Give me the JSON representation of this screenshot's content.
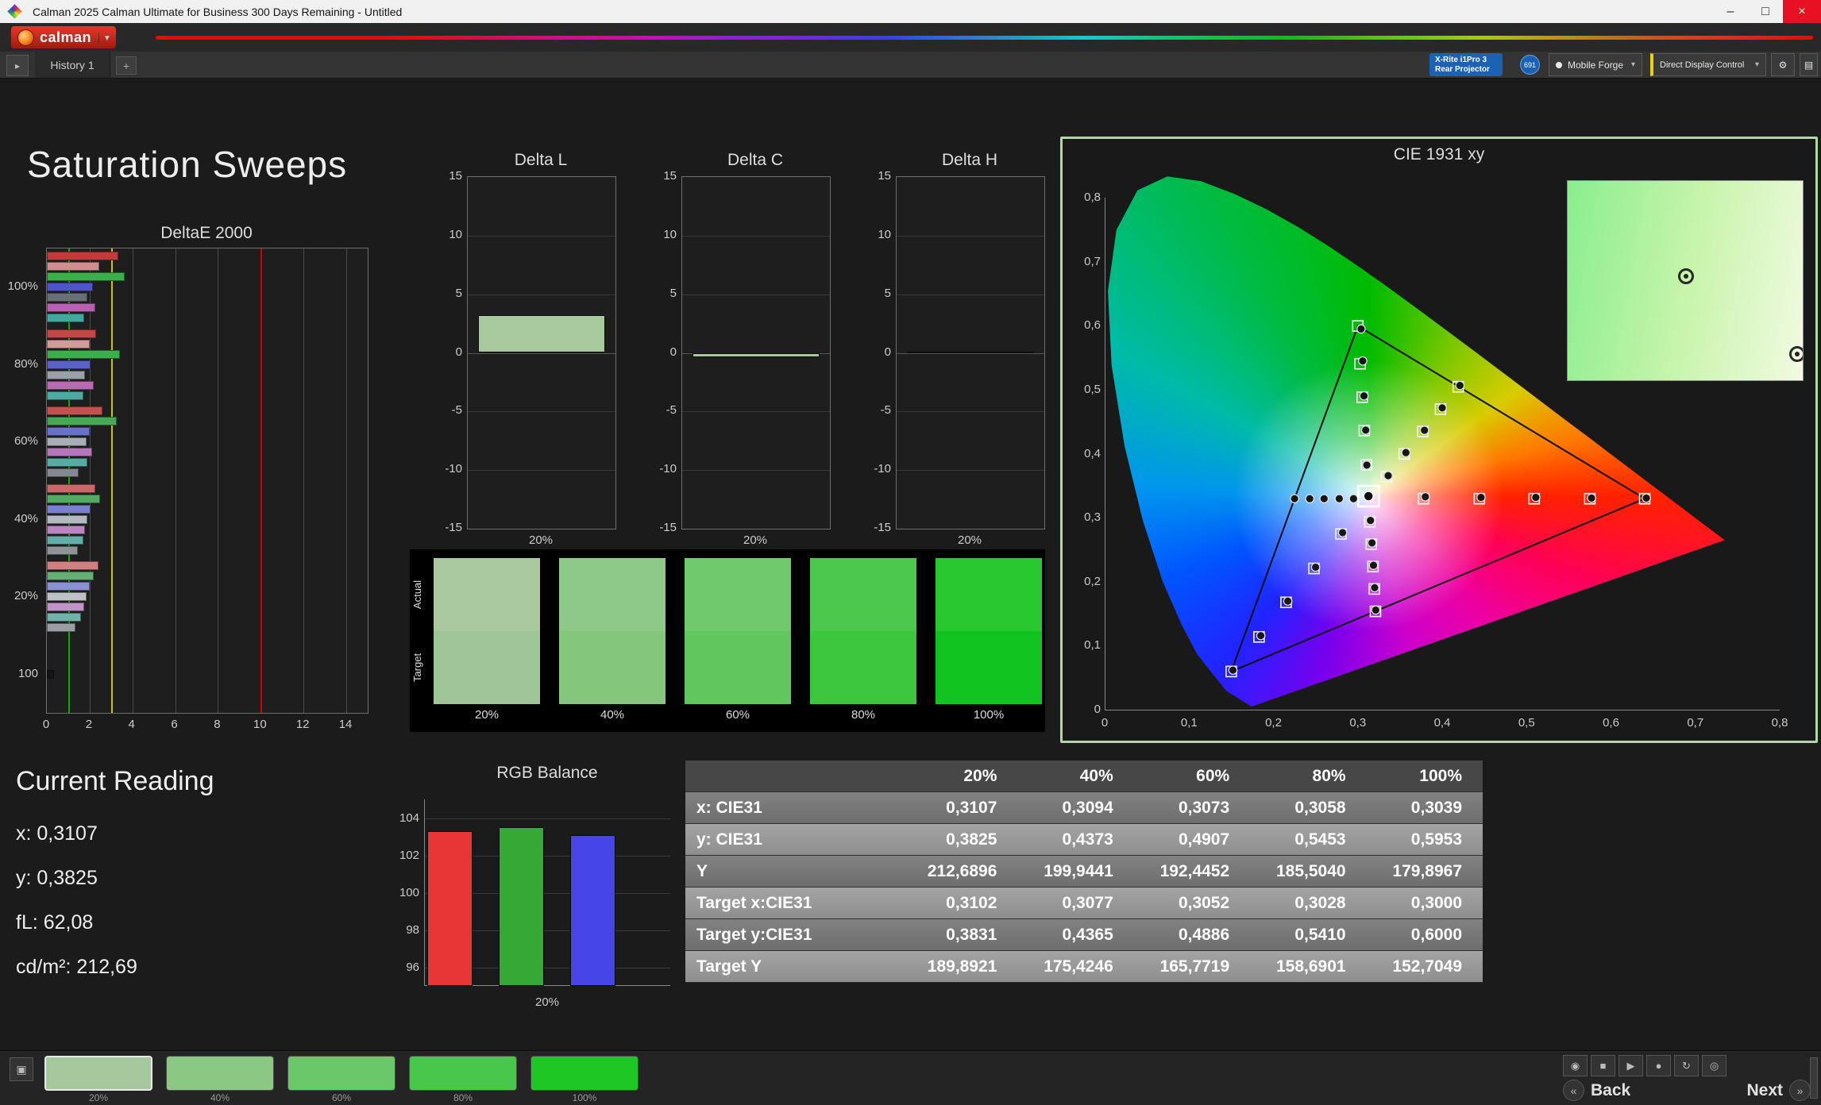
{
  "titlebar": {
    "title": "Calman 2025 Calman Ultimate for Business 300 Days Remaining  - Untitled"
  },
  "toolbar": {
    "brand": "calman"
  },
  "tabbar": {
    "tab": "History 1",
    "device_line1": "X-Rite i1Pro 3",
    "device_line2": "Rear Projector",
    "badge": "691",
    "source": "Mobile Forge",
    "display_control": "Direct Display Control"
  },
  "page": {
    "title": "Saturation Sweeps"
  },
  "icons": {
    "app": "◆",
    "minimize": "–",
    "maximize": "□",
    "close": "×",
    "caret": "▾",
    "history_toggle": "▸",
    "add_tab": "+",
    "gear": "⚙",
    "layout": "▤",
    "capture": "▣",
    "camera": "◉",
    "stop": "■",
    "play": "▶",
    "record": "●",
    "refresh": "↻",
    "power": "◎",
    "back_arrow": "«",
    "next_arrow": "»"
  },
  "deltae_chart": {
    "title": "DeltaE 2000",
    "xmax": 15,
    "xticks": [
      0,
      2,
      4,
      6,
      8,
      10,
      12,
      14
    ],
    "ref_lines": [
      {
        "value": 1,
        "color": "#00b400"
      },
      {
        "value": 3,
        "color": "#c8c800"
      },
      {
        "value": 10,
        "color": "#d40000"
      }
    ],
    "groups": [
      {
        "label": "100%",
        "bars": [
          {
            "color": "#c23a3a",
            "value": 3.35
          },
          {
            "color": "#cf8f8f",
            "value": 2.45
          },
          {
            "color": "#3dae4c",
            "value": 3.65
          },
          {
            "color": "#4d55c9",
            "value": 2.15
          },
          {
            "color": "#6a6f77",
            "value": 1.9
          },
          {
            "color": "#bb5fb4",
            "value": 2.25
          },
          {
            "color": "#43a8a0",
            "value": 1.75
          }
        ]
      },
      {
        "label": "80%",
        "bars": [
          {
            "color": "#c24747",
            "value": 2.3
          },
          {
            "color": "#d39a9a",
            "value": 2.0
          },
          {
            "color": "#3dae4c",
            "value": 3.4
          },
          {
            "color": "#5a62c9",
            "value": 2.05
          },
          {
            "color": "#9aa0a8",
            "value": 1.8
          },
          {
            "color": "#b76bb1",
            "value": 2.2
          },
          {
            "color": "#4daaa2",
            "value": 1.7
          }
        ]
      },
      {
        "label": "60%",
        "bars": [
          {
            "color": "#c25252",
            "value": 2.6
          },
          {
            "color": "#46a855",
            "value": 3.25
          },
          {
            "color": "#6a71c9",
            "value": 2.0
          },
          {
            "color": "#a8aeb6",
            "value": 1.85
          },
          {
            "color": "#b377ba",
            "value": 2.1
          },
          {
            "color": "#57aca4",
            "value": 1.9
          },
          {
            "color": "#84888f",
            "value": 1.5
          }
        ]
      },
      {
        "label": "40%",
        "bars": [
          {
            "color": "#c96868",
            "value": 2.25
          },
          {
            "color": "#55aa63",
            "value": 2.5
          },
          {
            "color": "#7a80cd",
            "value": 2.05
          },
          {
            "color": "#b3b9c0",
            "value": 1.9
          },
          {
            "color": "#ba85c0",
            "value": 1.8
          },
          {
            "color": "#63aea6",
            "value": 1.7
          },
          {
            "color": "#8f9399",
            "value": 1.45
          }
        ]
      },
      {
        "label": "20%",
        "bars": [
          {
            "color": "#d08080",
            "value": 2.4
          },
          {
            "color": "#66ae72",
            "value": 2.2
          },
          {
            "color": "#8a90d1",
            "value": 2.0
          },
          {
            "color": "#bdc2c9",
            "value": 1.85
          },
          {
            "color": "#c094c6",
            "value": 1.75
          },
          {
            "color": "#70b2aa",
            "value": 1.6
          },
          {
            "color": "#9a9ea4",
            "value": 1.35
          }
        ]
      },
      {
        "label": "100",
        "bars": [
          {
            "color": "#141414",
            "value": 0.35
          }
        ]
      }
    ]
  },
  "delta_yticks": [
    15,
    10,
    5,
    0,
    -5,
    -10,
    -15
  ],
  "delta_charts": [
    {
      "title": "Delta L",
      "value": 3.2,
      "color": "#a8c89e",
      "xlabel": "20%"
    },
    {
      "title": "Delta C",
      "value": -0.35,
      "color": "#a8c89e",
      "xlabel": "20%"
    },
    {
      "title": "Delta H",
      "value": 0.08,
      "color": "#1a1a1a",
      "xlabel": "20%"
    }
  ],
  "swatches": {
    "row_labels": [
      "Actual",
      "Target"
    ],
    "items": [
      {
        "label": "20%",
        "actual": "#aac9a1",
        "target": "#a0c599"
      },
      {
        "label": "40%",
        "actual": "#8fc987",
        "target": "#83c67c"
      },
      {
        "label": "60%",
        "actual": "#70c96c",
        "target": "#62c65f"
      },
      {
        "label": "80%",
        "actual": "#4cc94c",
        "target": "#3bc63e"
      },
      {
        "label": "100%",
        "actual": "#27c92e",
        "target": "#0fc41e"
      }
    ]
  },
  "cie": {
    "title": "CIE 1931 xy",
    "xtick_labels": [
      "0",
      "0,1",
      "0,2",
      "0,3",
      "0,4",
      "0,5",
      "0,6",
      "0,7",
      "0,8"
    ],
    "ytick_labels": [
      "0",
      "0,1",
      "0,2",
      "0,3",
      "0,4",
      "0,5",
      "0,6",
      "0,7",
      "0,8"
    ],
    "gamut": [
      [
        0.64,
        0.33
      ],
      [
        0.3,
        0.6
      ],
      [
        0.15,
        0.06
      ]
    ],
    "white_point": [
      0.3127,
      0.334
    ],
    "squares": [
      [
        0.378,
        0.33
      ],
      [
        0.444,
        0.33
      ],
      [
        0.509,
        0.33
      ],
      [
        0.575,
        0.33
      ],
      [
        0.64,
        0.33
      ],
      [
        0.3102,
        0.3831
      ],
      [
        0.3077,
        0.4365
      ],
      [
        0.3052,
        0.4886
      ],
      [
        0.3028,
        0.541
      ],
      [
        0.3,
        0.6
      ],
      [
        0.28,
        0.275
      ],
      [
        0.248,
        0.221
      ],
      [
        0.215,
        0.168
      ],
      [
        0.183,
        0.114
      ],
      [
        0.15,
        0.06
      ],
      [
        0.3143,
        0.294
      ],
      [
        0.316,
        0.259
      ],
      [
        0.318,
        0.224
      ],
      [
        0.3195,
        0.189
      ],
      [
        0.3209,
        0.154
      ],
      [
        0.334,
        0.364
      ],
      [
        0.355,
        0.4
      ],
      [
        0.377,
        0.435
      ],
      [
        0.398,
        0.47
      ],
      [
        0.419,
        0.505
      ]
    ],
    "circles": [
      [
        0.3107,
        0.3825
      ],
      [
        0.3094,
        0.4373
      ],
      [
        0.3073,
        0.4907
      ],
      [
        0.3058,
        0.5453
      ],
      [
        0.3039,
        0.5953
      ],
      [
        0.38,
        0.333
      ],
      [
        0.446,
        0.332
      ],
      [
        0.511,
        0.332
      ],
      [
        0.577,
        0.331
      ],
      [
        0.642,
        0.331
      ],
      [
        0.282,
        0.277
      ],
      [
        0.25,
        0.223
      ],
      [
        0.217,
        0.17
      ],
      [
        0.185,
        0.116
      ],
      [
        0.152,
        0.062
      ],
      [
        0.315,
        0.296
      ],
      [
        0.3168,
        0.261
      ],
      [
        0.3186,
        0.226
      ],
      [
        0.32,
        0.191
      ],
      [
        0.3212,
        0.156
      ],
      [
        0.336,
        0.366
      ],
      [
        0.357,
        0.402
      ],
      [
        0.379,
        0.437
      ],
      [
        0.4,
        0.472
      ],
      [
        0.421,
        0.507
      ],
      [
        0.295,
        0.33
      ],
      [
        0.278,
        0.33
      ],
      [
        0.26,
        0.33
      ],
      [
        0.243,
        0.33
      ],
      [
        0.225,
        0.33
      ],
      [
        0.3127,
        0.334
      ]
    ],
    "inset_markers": [
      [
        0.505,
        0.48
      ],
      [
        0.975,
        0.87
      ]
    ]
  },
  "current_reading": {
    "title": "Current Reading",
    "lines": [
      "x: 0,3107",
      "y: 0,3825",
      "fL: 62,08",
      "cd/m²: 212,69"
    ]
  },
  "rgb_chart": {
    "title": "RGB Balance",
    "xlabel": "20%",
    "ymin": 95,
    "ymax": 105,
    "yticks": [
      104,
      102,
      100,
      98,
      96
    ],
    "bars": [
      {
        "name": "red",
        "value": 103.3,
        "color": "#e83535"
      },
      {
        "name": "green",
        "value": 103.5,
        "color": "#35a835"
      },
      {
        "name": "blue",
        "value": 103.1,
        "color": "#4545e8"
      }
    ]
  },
  "table": {
    "headers": [
      "",
      "20%",
      "40%",
      "60%",
      "80%",
      "100%"
    ],
    "rows": [
      {
        "label": "x: CIE31",
        "values": [
          "0,3107",
          "0,3094",
          "0,3073",
          "0,3058",
          "0,3039"
        ]
      },
      {
        "label": "y: CIE31",
        "values": [
          "0,3825",
          "0,4373",
          "0,4907",
          "0,5453",
          "0,5953"
        ]
      },
      {
        "label": "Y",
        "values": [
          "212,6896",
          "199,9441",
          "192,4452",
          "185,5040",
          "179,8967"
        ]
      },
      {
        "label": "Target x:CIE31",
        "values": [
          "0,3102",
          "0,3077",
          "0,3052",
          "0,3028",
          "0,3000"
        ]
      },
      {
        "label": "Target y:CIE31",
        "values": [
          "0,3831",
          "0,4365",
          "0,4886",
          "0,5410",
          "0,6000"
        ]
      },
      {
        "label": "Target Y",
        "values": [
          "189,8921",
          "175,4246",
          "165,7719",
          "158,6901",
          "152,7049"
        ]
      }
    ]
  },
  "bottom_bar": {
    "back_label": "Back",
    "next_label": "Next",
    "swatches": [
      {
        "label": "20%",
        "color": "#a5c89d",
        "selected": true
      },
      {
        "label": "40%",
        "color": "#8ac884",
        "selected": false
      },
      {
        "label": "60%",
        "color": "#6bc868",
        "selected": false
      },
      {
        "label": "80%",
        "color": "#49c74a",
        "selected": false
      },
      {
        "label": "100%",
        "color": "#1ec723",
        "selected": false
      }
    ]
  }
}
